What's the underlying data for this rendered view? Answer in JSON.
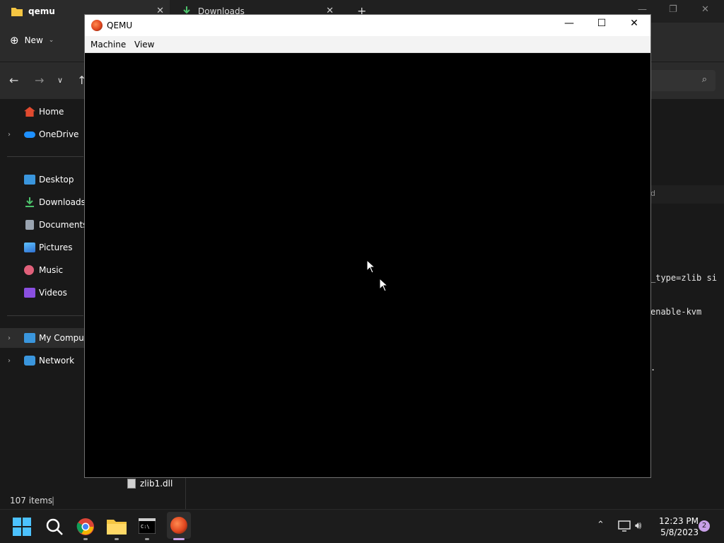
{
  "explorer": {
    "tabs": [
      {
        "label": "qemu",
        "icon": "folder-icon"
      },
      {
        "label": "Downloads",
        "icon": "download-icon"
      }
    ],
    "new_button_label": "New",
    "sidebar": {
      "items": [
        {
          "label": "Home",
          "icon": "home-icon",
          "color": "#e04a2f"
        },
        {
          "label": "OneDrive",
          "icon": "onedrive-icon",
          "color": "#1e90ff"
        },
        {
          "label": "Desktop",
          "icon": "desktop-icon",
          "color": "#3a96dd"
        },
        {
          "label": "Downloads",
          "icon": "download-icon",
          "color": "#4cc26b"
        },
        {
          "label": "Documents",
          "icon": "documents-icon",
          "color": "#9aa4b0"
        },
        {
          "label": "Pictures",
          "icon": "pictures-icon",
          "color": "#2f8fe0"
        },
        {
          "label": "Music",
          "icon": "music-icon",
          "color": "#e0607a"
        },
        {
          "label": "Videos",
          "icon": "videos-icon",
          "color": "#8a4fe0"
        },
        {
          "label": "My Comput",
          "icon": "computer-icon",
          "color": "#3a96dd"
        },
        {
          "label": "Network",
          "icon": "network-icon",
          "color": "#3a96dd"
        }
      ]
    },
    "column_header_fragment": "d",
    "content_fragments": [
      "_type=zlib si",
      "enable-kvm",
      "."
    ],
    "visible_file": {
      "name": "zlib1.dll",
      "icon": "dll-file-icon"
    },
    "status": {
      "item_count": "107 items"
    }
  },
  "qemu": {
    "title": "QEMU",
    "menu": [
      "Machine",
      "View"
    ]
  },
  "taskbar": {
    "apps": [
      "start-icon",
      "search-icon",
      "chrome-icon",
      "file-explorer-icon",
      "terminal-icon",
      "qemu-icon"
    ],
    "clock": {
      "time": "12:23 PM",
      "date": "5/8/2023"
    },
    "notification_count": "2"
  }
}
